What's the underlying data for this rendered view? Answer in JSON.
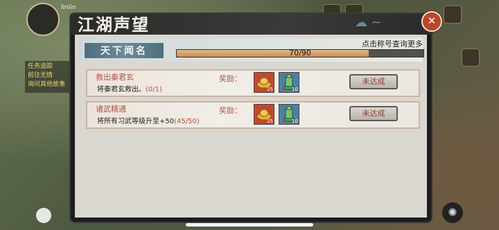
{
  "background": {
    "player_name": "linlin",
    "quest_lines": [
      "任务追踪",
      "前往无情",
      "询问其他故事"
    ]
  },
  "dialog": {
    "title": "江湖声望",
    "close_symbol": "✕",
    "fame": {
      "label": "天下闻名",
      "hint": "点击称号查询更多",
      "current": 70,
      "max": 90,
      "progress_text": "70/90"
    },
    "tasks": [
      {
        "name": "救出秦君玄",
        "desc": "将秦君玄救出。",
        "progress": "(0/1)",
        "reward_label": "奖励：",
        "rewards": [
          {
            "type": "gold-ingot-icon",
            "count": "25"
          },
          {
            "type": "tower-icon",
            "count": "10"
          }
        ],
        "status": "未达成"
      },
      {
        "name": "诸武精通",
        "desc": "将所有习武等级升至+50",
        "progress": "(45/50)",
        "reward_label": "奖励：",
        "rewards": [
          {
            "type": "gold-ingot-icon",
            "count": "25"
          },
          {
            "type": "tower-icon",
            "count": "10"
          }
        ],
        "status": "未达成"
      }
    ]
  },
  "colors": {
    "accent_red": "#b25243",
    "progress_fill": "#c48e5c",
    "close_button": "#b8462c"
  }
}
